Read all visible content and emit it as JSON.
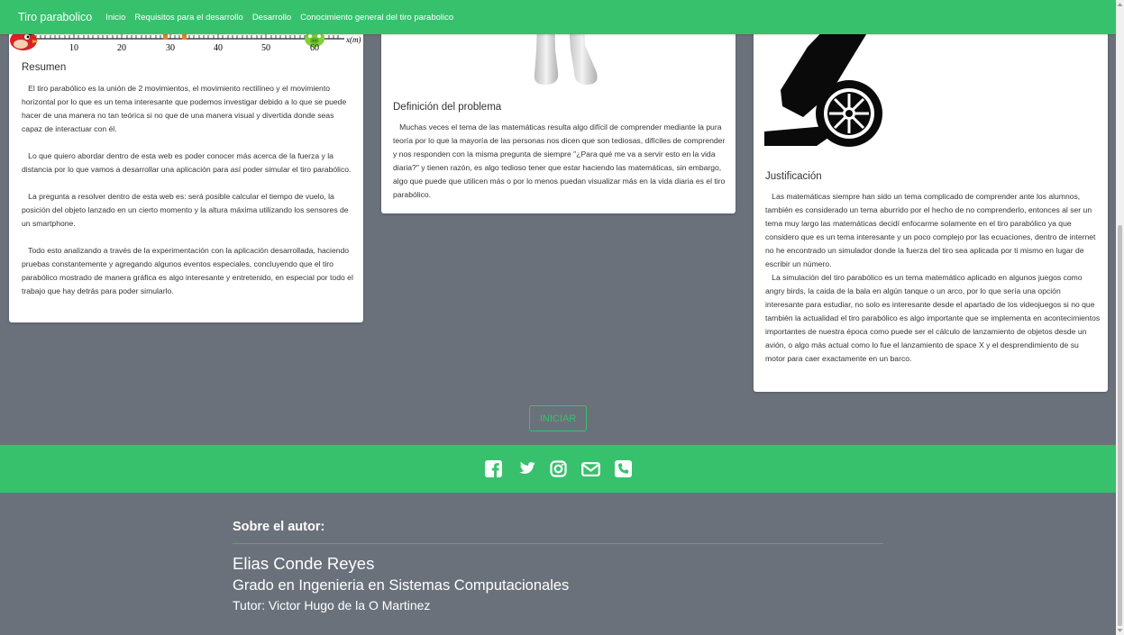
{
  "navbar": {
    "brand": "Tiro parabolico",
    "links": [
      "Inicio",
      "Requisitos para el desarrollo",
      "Desarrollo",
      "Conocimiento general del tiro parabolico"
    ]
  },
  "card_resumen": {
    "axis_ticks": [
      "10",
      "20",
      "30",
      "40",
      "50",
      "60"
    ],
    "axis_label": "x(m)",
    "title": "Resumen",
    "paragraphs": [
      "   El tiro parabólico es la unión de 2 movimientos, el movimiento rectilíneo y el movimiento horizontal por lo que es un tema interesante que podemos investigar debido a lo que se puede hacer de una manera no tan teórica si no que de una manera visual y divertida donde seas capaz de interactuar con él.",
      "   Lo que quiero abordar dentro de esta web es poder conocer más acerca de la fuerza y la distancia por lo que vamos a desarrollar una aplicación para así poder simular el tiro parabólico.",
      "   La pregunta a resolver dentro de esta web es: será posible calcular el tiempo de vuelo, la posición del objeto lanzado en un cierto momento y la altura máxima utilizando los sensores de un smartphone.",
      "   Todo esto analizando a través de la experimentación con la aplicación desarrollada, haciendo pruebas constantemente y agregando algunos eventos especiales, concluyendo que el tiro parabólico mostrado de manera gráfica es algo interesante y entretenido, en especial por todo el trabajo que hay detrás para poder simularlo."
    ]
  },
  "card_definicion": {
    "title": "Definición del problema",
    "paragraphs": [
      "   Muchas veces el tema de las matemáticas resulta algo difícil de comprender mediante la pura teoría por lo que la mayoría de las personas nos dicen que son tediosas, difíciles de comprender y nos responden con la misma pregunta de siempre \"¿Para qué me va a servir esto en la vida diaria?\" y tienen razón, es algo tedioso tener que estar haciendo las matemáticas, sin embargo, algo que puede que utilicen más o por lo menos puedan visualizar más en la vida diaria es el tiro parabólico."
    ]
  },
  "card_justificacion": {
    "title": "Justificación",
    "paragraphs": [
      "   Las matemáticas siempre han sido un tema complicado de comprender ante los alumnos, también es considerado un tema aburrido por el hecho de no comprenderlo, entonces al ser un tema muy largo las matemáticas decidí enfocarme solamente en el tiro parabólico ya que considero que es un tema interesante y un poco complejo por las ecuaciones, dentro de internet no he encontrado un simulador donde la fuerza del tiro sea aplicada por ti mismo en lugar de escribir un número.",
      "   La simulación del tiro parabólico es un tema matemático aplicado en algunos juegos como angry birds, la caida de la bala en algún tanque o un arco, por lo que sería una opción interesante para estudiar, no solo es interesante desde el apartado de los videojuegos si no que también la actualidad el tiro parabólico es algo importante que se implementa en acontecimientos importantes de nuestra época como puede ser el cálculo de lanzamiento de objetos desde un avión, o algo más actual como lo fue el lanzamiento de space X y el desprendimiento de su motor para caer exactamente en un barco."
    ]
  },
  "start_button": "INICIAR",
  "social_icons": [
    "facebook-icon",
    "twitter-icon",
    "instagram-icon",
    "envelope-icon",
    "phone-icon"
  ],
  "author": {
    "heading": "Sobre el autor:",
    "name": "Elias Conde Reyes",
    "degree": "Grado en Ingenieria en Sistemas Computacionales",
    "tutor": "Tutor: Victor Hugo de la O Martinez"
  },
  "colors": {
    "accent": "#37c16d",
    "background": "#6b717b",
    "card": "#ffffff"
  }
}
